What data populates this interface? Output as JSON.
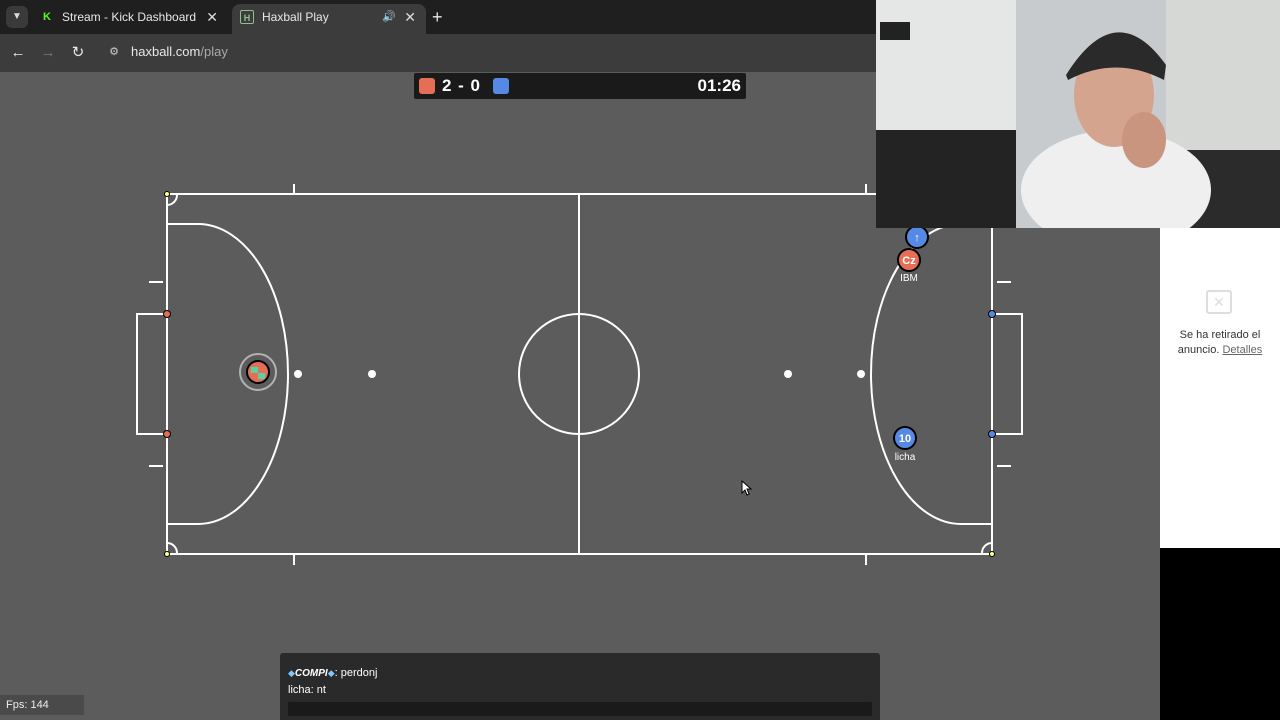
{
  "browser": {
    "tabs": [
      {
        "label": "Stream - Kick Dashboard",
        "icon": "kick-logo-icon"
      },
      {
        "label": "Haxball Play",
        "icon": "haxball-logo-icon"
      }
    ],
    "url_domain": "haxball.com",
    "url_path": "/play"
  },
  "scoreboard": {
    "score": "2 - 0",
    "time": "01:26",
    "red_color": "#e56e56",
    "blue_color": "#5689e5"
  },
  "players": [
    {
      "label": "Cz",
      "name": "IBM",
      "team": "red"
    },
    {
      "label": "10",
      "name": "licha",
      "team": "blue"
    },
    {
      "label": "↑",
      "name": "",
      "team": "blue"
    }
  ],
  "chat": {
    "lines": [
      {
        "nick": "COMPI",
        "text": ": perdonj"
      },
      {
        "nick": "",
        "text": "licha: nt"
      }
    ]
  },
  "fps": "Fps: 144",
  "ad": {
    "text": "Se ha retirado el anuncio.",
    "link": "Detalles"
  }
}
